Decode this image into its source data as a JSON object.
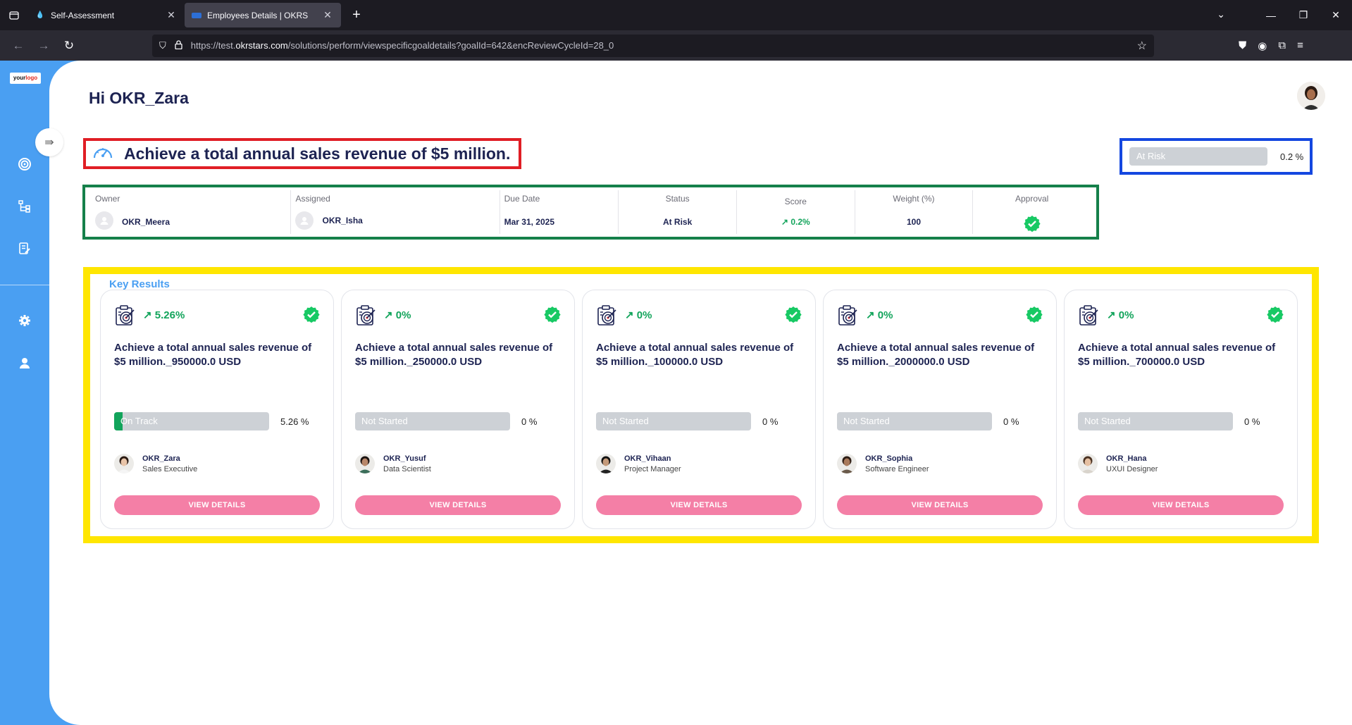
{
  "browser": {
    "tabs": [
      {
        "title": "Self-Assessment",
        "active": false
      },
      {
        "title": "Employees Details | OKRS",
        "active": true
      }
    ],
    "url_prefix": "https://test.",
    "url_domain": "okrstars.com",
    "url_path": "/solutions/perform/viewspecificgoaldetails?goalId=642&encReviewCycleId=28_0"
  },
  "sidebar": {
    "logo_text": "your",
    "logo_accent": "logo",
    "items": [
      "target-icon",
      "hierarchy-icon",
      "edit-document-icon",
      "settings-icon",
      "user-icon"
    ]
  },
  "header": {
    "greeting": "Hi OKR_Zara"
  },
  "goal": {
    "title": "Achieve a total annual sales revenue of $5 million.",
    "status_bar_label": "At Risk",
    "status_pct": "0.2 %",
    "meta": {
      "owner_label": "Owner",
      "owner": "OKR_Meera",
      "assigned_label": "Assigned",
      "assigned": "OKR_Isha",
      "due_label": "Due Date",
      "due": "Mar 31, 2025",
      "status_label": "Status",
      "status": "At Risk",
      "score_label": "Score",
      "score": "0.2%",
      "weight_label": "Weight (%)",
      "weight": "100",
      "approval_label": "Approval"
    }
  },
  "key_results": {
    "heading": "Key Results",
    "button_label": "VIEW DETAILS",
    "items": [
      {
        "trend": "5.26%",
        "name": "Achieve a total annual sales revenue of $5 million._950000.0 USD",
        "status": "On Track",
        "progress": 5.26,
        "pct": "5.26 %",
        "person": "OKR_Zara",
        "role": "Sales Executive",
        "skin": "#e8c4a8",
        "hair": "#2a1a12",
        "shirt": "#f5f5f5"
      },
      {
        "trend": "0%",
        "name": "Achieve a total annual sales revenue of $5 million._250000.0 USD",
        "status": "Not Started",
        "progress": 0,
        "pct": "0 %",
        "person": "OKR_Yusuf",
        "role": "Data Scientist",
        "skin": "#b8876a",
        "hair": "#1a1210",
        "shirt": "#3c6e5a"
      },
      {
        "trend": "0%",
        "name": "Achieve a total annual sales revenue of $5 million._100000.0 USD",
        "status": "Not Started",
        "progress": 0,
        "pct": "0 %",
        "person": "OKR_Vihaan",
        "role": "Project Manager",
        "skin": "#c49a7a",
        "hair": "#111111",
        "shirt": "#222222"
      },
      {
        "trend": "0%",
        "name": "Achieve a total annual sales revenue of $5 million._2000000.0 USD",
        "status": "Not Started",
        "progress": 0,
        "pct": "0 %",
        "person": "OKR_Sophia",
        "role": "Software Engineer",
        "skin": "#a97a5c",
        "hair": "#2c1c14",
        "shirt": "#6a5a4a"
      },
      {
        "trend": "0%",
        "name": "Achieve a total annual sales revenue of $5 million._700000.0 USD",
        "status": "Not Started",
        "progress": 0,
        "pct": "0 %",
        "person": "OKR_Hana",
        "role": "UXUI Designer",
        "skin": "#e6c0a2",
        "hair": "#4a3222",
        "shirt": "#d9d4cc"
      }
    ]
  }
}
